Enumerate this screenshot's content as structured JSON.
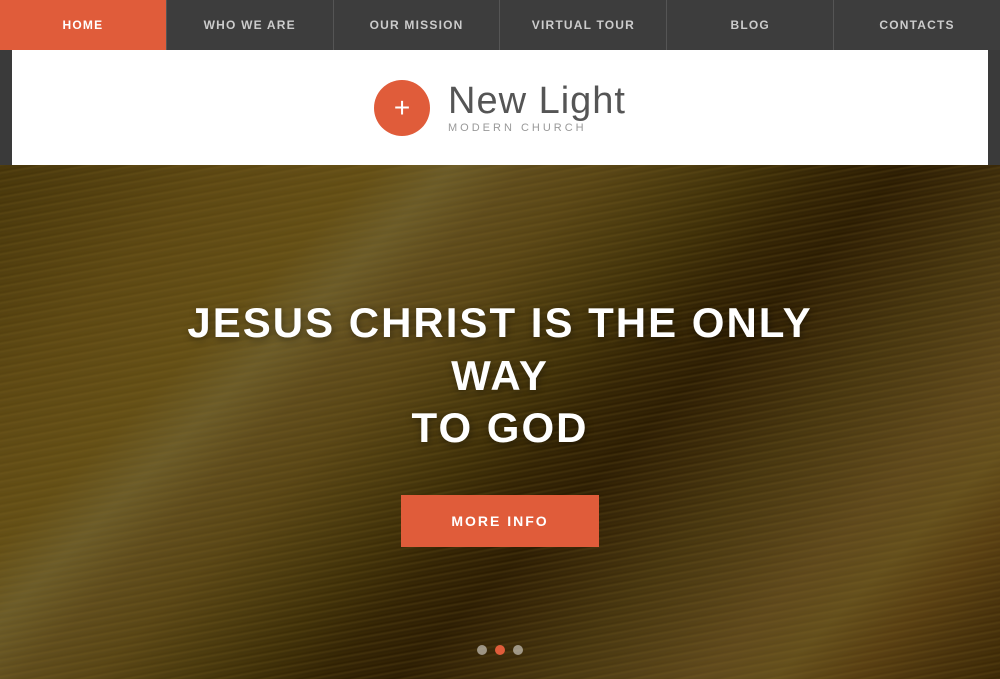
{
  "nav": {
    "items": [
      {
        "label": "HOME",
        "active": true
      },
      {
        "label": "WHO WE ARE",
        "active": false
      },
      {
        "label": "OUR MISSION",
        "active": false
      },
      {
        "label": "VIRTUAL TOUR",
        "active": false
      },
      {
        "label": "BLOG",
        "active": false
      },
      {
        "label": "CONTACTS",
        "active": false
      }
    ]
  },
  "logo": {
    "icon_symbol": "+",
    "name": "New Light",
    "tagline": "MODERN CHURCH"
  },
  "hero": {
    "headline_line1": "JESUS CHRIST IS THE ONLY WAY",
    "headline_line2": "TO GOD",
    "cta_label": "MORE INFO"
  },
  "carousel": {
    "dots": [
      {
        "active": false
      },
      {
        "active": true
      },
      {
        "active": false
      }
    ]
  }
}
